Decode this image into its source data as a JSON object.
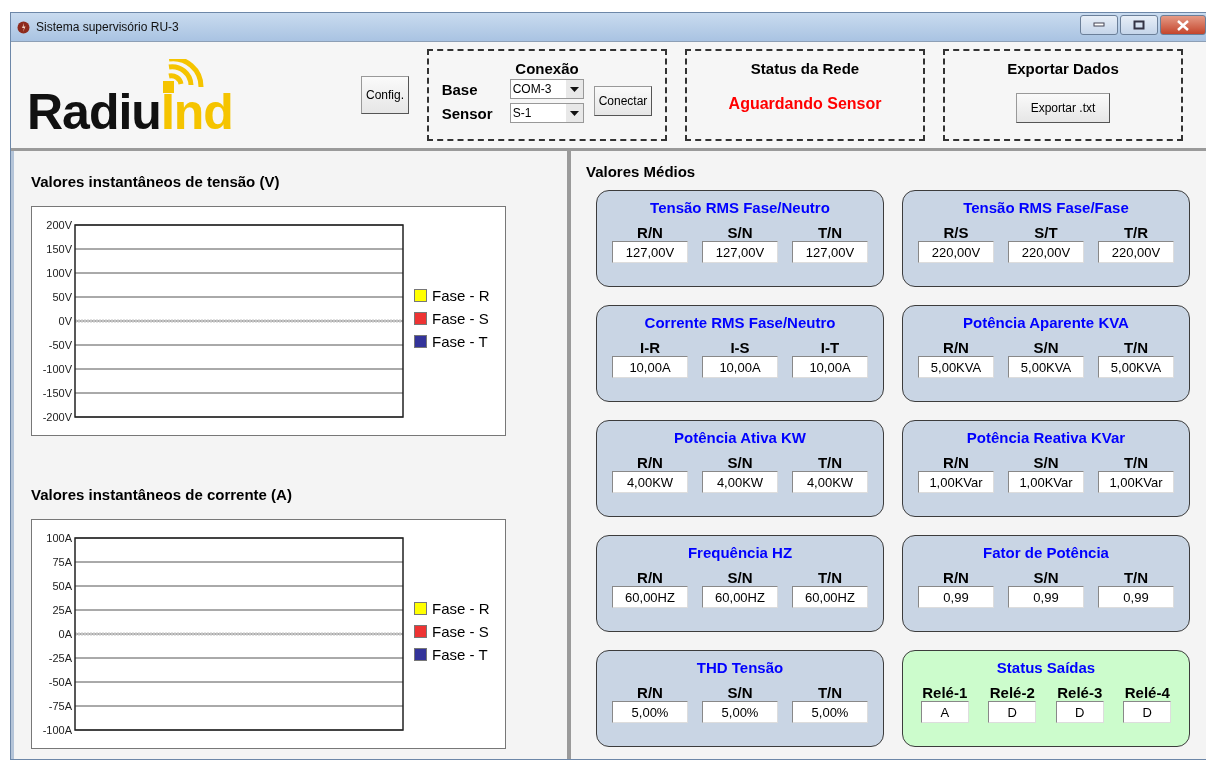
{
  "window": {
    "title": "Sistema supervisório RU-3"
  },
  "header": {
    "logo": {
      "text_dark": "Radiu",
      "text_accent": "Ind"
    },
    "config_button": "Config.",
    "connection": {
      "title": "Conexão",
      "fields": [
        {
          "label": "Base",
          "value": "COM-3"
        },
        {
          "label": "Sensor",
          "value": "S-1"
        }
      ],
      "button": "Conectar"
    },
    "network_status": {
      "title": "Status da Rede",
      "status": "Aguardando Sensor"
    },
    "export": {
      "title": "Exportar Dados",
      "button": "Exportar .txt"
    }
  },
  "charts": [
    {
      "title": "Valores instantâneos de tensão (V)",
      "chart_data": {
        "type": "line",
        "grid": true,
        "ref_lines": [
          {
            "axis": "y",
            "value": 0,
            "color": "#c4c4c4"
          }
        ],
        "ylim": [
          -200,
          200
        ],
        "yticks": [
          {
            "value": 200,
            "label": "200V"
          },
          {
            "value": 150,
            "label": "150V"
          },
          {
            "value": 100,
            "label": "100V"
          },
          {
            "value": 50,
            "label": "50V"
          },
          {
            "value": 0,
            "label": "0V"
          },
          {
            "value": -50,
            "label": "-50V"
          },
          {
            "value": -100,
            "label": "-100V"
          },
          {
            "value": -150,
            "label": "-150V"
          },
          {
            "value": -200,
            "label": "-200V"
          }
        ],
        "series": [
          {
            "name": "Fase - R",
            "color": "#ffff00",
            "values": [
              null
            ]
          },
          {
            "name": "Fase - S",
            "color": "#ee3333",
            "values": [
              null
            ]
          },
          {
            "name": "Fase - T",
            "color": "#333399",
            "values": [
              null
            ]
          }
        ]
      }
    },
    {
      "title": "Valores instantâneos de corrente (A)",
      "chart_data": {
        "type": "line",
        "grid": true,
        "ref_lines": [
          {
            "axis": "y",
            "value": 0,
            "color": "#c4c4c4"
          }
        ],
        "ylim": [
          -100,
          100
        ],
        "yticks": [
          {
            "value": 100,
            "label": "100A"
          },
          {
            "value": 75,
            "label": "75A"
          },
          {
            "value": 50,
            "label": "50A"
          },
          {
            "value": 25,
            "label": "25A"
          },
          {
            "value": 0,
            "label": "0A"
          },
          {
            "value": -25,
            "label": "-25A"
          },
          {
            "value": -50,
            "label": "-50A"
          },
          {
            "value": -75,
            "label": "-75A"
          },
          {
            "value": -100,
            "label": "-100A"
          }
        ],
        "series": [
          {
            "name": "Fase - R",
            "color": "#ffff00",
            "values": [
              null
            ]
          },
          {
            "name": "Fase - S",
            "color": "#ee3333",
            "values": [
              null
            ]
          },
          {
            "name": "Fase - T",
            "color": "#333399",
            "values": [
              null
            ]
          }
        ]
      }
    }
  ],
  "averages": {
    "title": "Valores Médios",
    "cards": [
      {
        "title": "Tensão RMS Fase/Neutro",
        "kind": "measure",
        "fields": [
          {
            "label": "R/N",
            "value": "127,00V"
          },
          {
            "label": "S/N",
            "value": "127,00V"
          },
          {
            "label": "T/N",
            "value": "127,00V"
          }
        ]
      },
      {
        "title": "Tensão RMS Fase/Fase",
        "kind": "measure",
        "fields": [
          {
            "label": "R/S",
            "value": "220,00V"
          },
          {
            "label": "S/T",
            "value": "220,00V"
          },
          {
            "label": "T/R",
            "value": "220,00V"
          }
        ]
      },
      {
        "title": "Corrente RMS Fase/Neutro",
        "kind": "measure",
        "fields": [
          {
            "label": "I-R",
            "value": "10,00A"
          },
          {
            "label": "I-S",
            "value": "10,00A"
          },
          {
            "label": "I-T",
            "value": "10,00A"
          }
        ]
      },
      {
        "title": "Potência Aparente KVA",
        "kind": "measure",
        "fields": [
          {
            "label": "R/N",
            "value": "5,00KVA"
          },
          {
            "label": "S/N",
            "value": "5,00KVA"
          },
          {
            "label": "T/N",
            "value": "5,00KVA"
          }
        ]
      },
      {
        "title": "Potência Ativa KW",
        "kind": "measure",
        "fields": [
          {
            "label": "R/N",
            "value": "4,00KW"
          },
          {
            "label": "S/N",
            "value": "4,00KW"
          },
          {
            "label": "T/N",
            "value": "4,00KW"
          }
        ]
      },
      {
        "title": "Potência Reativa KVar",
        "kind": "measure",
        "fields": [
          {
            "label": "R/N",
            "value": "1,00KVar"
          },
          {
            "label": "S/N",
            "value": "1,00KVar"
          },
          {
            "label": "T/N",
            "value": "1,00KVar"
          }
        ]
      },
      {
        "title": "Frequência HZ",
        "kind": "measure",
        "fields": [
          {
            "label": "R/N",
            "value": "60,00HZ"
          },
          {
            "label": "S/N",
            "value": "60,00HZ"
          },
          {
            "label": "T/N",
            "value": "60,00HZ"
          }
        ]
      },
      {
        "title": "Fator de Potência",
        "kind": "measure",
        "fields": [
          {
            "label": "R/N",
            "value": "0,99"
          },
          {
            "label": "S/N",
            "value": "0,99"
          },
          {
            "label": "T/N",
            "value": "0,99"
          }
        ]
      },
      {
        "title": "THD Tensão",
        "kind": "measure",
        "fields": [
          {
            "label": "R/N",
            "value": "5,00%"
          },
          {
            "label": "S/N",
            "value": "5,00%"
          },
          {
            "label": "T/N",
            "value": "5,00%"
          }
        ]
      },
      {
        "title": "Status Saídas",
        "kind": "outputs",
        "fields": [
          {
            "label": "Relé-1",
            "value": "A"
          },
          {
            "label": "Relé-2",
            "value": "D"
          },
          {
            "label": "Relé-3",
            "value": "D"
          },
          {
            "label": "Relé-4",
            "value": "D"
          }
        ]
      }
    ]
  }
}
